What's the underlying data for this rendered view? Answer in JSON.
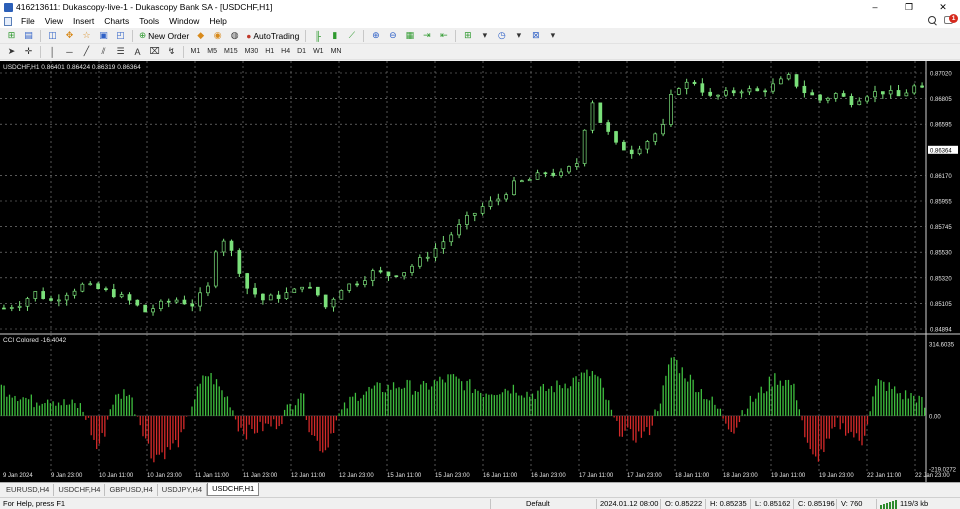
{
  "window": {
    "title": "416213611: Dukascopy-live-1 - Dukascopy Bank SA - [USDCHF,H1]",
    "controls": [
      "–",
      "❐",
      "✕"
    ]
  },
  "menu": {
    "items": [
      "File",
      "View",
      "Insert",
      "Charts",
      "Tools",
      "Window",
      "Help"
    ],
    "notification_count": "1"
  },
  "toolbar": {
    "new_order_label": "New Order",
    "autotrading_label": "AutoTrading",
    "timeframes": [
      "M1",
      "M5",
      "M15",
      "M30",
      "H1",
      "H4",
      "D1",
      "W1",
      "MN"
    ],
    "text_tool": "A"
  },
  "chart": {
    "symbol_info": "USDCHF,H1  0.86401 0.86424 0.86319 0.86364",
    "indicator_info": "CCI Colored -16.4042",
    "colors": {
      "background": "#000000",
      "candle": "#7be07b",
      "grid": "#8c8c8c",
      "cci_up": "#3fbf3f",
      "cci_down": "#d42a2a",
      "text": "#e6e6e6"
    },
    "current_price": "0.86364"
  },
  "chart_data": {
    "type": "candlestick",
    "price_axis_labels": [
      "0.87020",
      "0.86805",
      "0.86595",
      "0.86364",
      "0.86170",
      "0.85955",
      "0.85745",
      "0.85530",
      "0.85320",
      "0.85105",
      "0.84894"
    ],
    "cci_axis_labels": [
      "314.6035",
      "0.00",
      "-219.0272"
    ],
    "time_labels": [
      "9 Jan 2024",
      "9 Jan 23:00",
      "10 Jan 11:00",
      "10 Jan 23:00",
      "11 Jan 11:00",
      "11 Jan 23:00",
      "12 Jan 11:00",
      "12 Jan 23:00",
      "15 Jan 11:00",
      "15 Jan 23:00",
      "16 Jan 11:00",
      "16 Jan 23:00",
      "17 Jan 11:00",
      "17 Jan 23:00",
      "18 Jan 11:00",
      "18 Jan 23:00",
      "19 Jan 11:00",
      "19 Jan 23:00",
      "22 Jan 11:00",
      "22 Jan 23:00"
    ],
    "price_path": [
      [
        0,
        0.8508
      ],
      [
        2,
        0.8512
      ],
      [
        4,
        0.8521
      ],
      [
        6,
        0.8514
      ],
      [
        8,
        0.8521
      ],
      [
        10,
        0.8527
      ],
      [
        12,
        0.8524
      ],
      [
        14,
        0.852
      ],
      [
        16,
        0.8514
      ],
      [
        18,
        0.8505
      ],
      [
        20,
        0.8511
      ],
      [
        22,
        0.8515
      ],
      [
        24,
        0.8511
      ],
      [
        26,
        0.8525
      ],
      [
        27,
        0.8558
      ],
      [
        28,
        0.8566
      ],
      [
        29,
        0.8555
      ],
      [
        30,
        0.854
      ],
      [
        31,
        0.8525
      ],
      [
        33,
        0.8515
      ],
      [
        35,
        0.8518
      ],
      [
        37,
        0.8522
      ],
      [
        38,
        0.8528
      ],
      [
        40,
        0.8519
      ],
      [
        41,
        0.8509
      ],
      [
        43,
        0.8525
      ],
      [
        45,
        0.853
      ],
      [
        47,
        0.8538
      ],
      [
        49,
        0.8536
      ],
      [
        51,
        0.8539
      ],
      [
        53,
        0.8548
      ],
      [
        55,
        0.8558
      ],
      [
        57,
        0.857
      ],
      [
        59,
        0.8583
      ],
      [
        61,
        0.8593
      ],
      [
        63,
        0.86
      ],
      [
        65,
        0.8612
      ],
      [
        67,
        0.8616
      ],
      [
        69,
        0.8622
      ],
      [
        71,
        0.862
      ],
      [
        73,
        0.863
      ],
      [
        74,
        0.866
      ],
      [
        75,
        0.8682
      ],
      [
        76,
        0.8665
      ],
      [
        78,
        0.8645
      ],
      [
        80,
        0.864
      ],
      [
        82,
        0.8649
      ],
      [
        84,
        0.866
      ],
      [
        85,
        0.8685
      ],
      [
        86,
        0.8695
      ],
      [
        88,
        0.8698
      ],
      [
        90,
        0.8685
      ],
      [
        92,
        0.8688
      ],
      [
        94,
        0.8692
      ],
      [
        96,
        0.869
      ],
      [
        98,
        0.8695
      ],
      [
        100,
        0.8702
      ],
      [
        102,
        0.869
      ],
      [
        104,
        0.8683
      ],
      [
        106,
        0.8688
      ],
      [
        108,
        0.8682
      ],
      [
        110,
        0.8688
      ],
      [
        112,
        0.869
      ],
      [
        114,
        0.8686
      ],
      [
        116,
        0.8694
      ],
      [
        117,
        0.8691
      ]
    ],
    "cci_path": [
      [
        0,
        120
      ],
      [
        2,
        90
      ],
      [
        4,
        60
      ],
      [
        6,
        80
      ],
      [
        8,
        50
      ],
      [
        10,
        40
      ],
      [
        11,
        -20
      ],
      [
        12,
        -140
      ],
      [
        13,
        -80
      ],
      [
        14,
        60
      ],
      [
        16,
        110
      ],
      [
        18,
        -60
      ],
      [
        19,
        -170
      ],
      [
        21,
        -150
      ],
      [
        23,
        -90
      ],
      [
        24,
        40
      ],
      [
        26,
        180
      ],
      [
        27,
        150
      ],
      [
        28,
        100
      ],
      [
        29,
        60
      ],
      [
        30,
        -40
      ],
      [
        31,
        -70
      ],
      [
        33,
        -50
      ],
      [
        35,
        -30
      ],
      [
        37,
        60
      ],
      [
        38,
        110
      ],
      [
        39,
        -40
      ],
      [
        40,
        -110
      ],
      [
        41,
        -150
      ],
      [
        42,
        -50
      ],
      [
        43,
        10
      ],
      [
        45,
        90
      ],
      [
        47,
        110
      ],
      [
        49,
        120
      ],
      [
        51,
        130
      ],
      [
        53,
        110
      ],
      [
        55,
        140
      ],
      [
        57,
        160
      ],
      [
        59,
        130
      ],
      [
        61,
        100
      ],
      [
        63,
        110
      ],
      [
        65,
        120
      ],
      [
        67,
        90
      ],
      [
        69,
        110
      ],
      [
        71,
        130
      ],
      [
        73,
        160
      ],
      [
        75,
        180
      ],
      [
        76,
        130
      ],
      [
        77,
        40
      ],
      [
        78,
        -50
      ],
      [
        80,
        -90
      ],
      [
        82,
        -70
      ],
      [
        84,
        120
      ],
      [
        85,
        260
      ],
      [
        86,
        200
      ],
      [
        88,
        130
      ],
      [
        90,
        60
      ],
      [
        91,
        20
      ],
      [
        92,
        -30
      ],
      [
        93,
        -60
      ],
      [
        94,
        30
      ],
      [
        96,
        90
      ],
      [
        98,
        160
      ],
      [
        100,
        140
      ],
      [
        101,
        70
      ],
      [
        102,
        -120
      ],
      [
        103,
        -190
      ],
      [
        104,
        -150
      ],
      [
        105,
        -100
      ],
      [
        106,
        -30
      ],
      [
        108,
        -80
      ],
      [
        109,
        -120
      ],
      [
        110,
        20
      ],
      [
        111,
        140
      ],
      [
        112,
        130
      ],
      [
        114,
        90
      ],
      [
        116,
        80
      ],
      [
        117,
        40
      ]
    ],
    "price_range": [
      0.8487,
      0.8709
    ],
    "cci_range": [
      -219.0272,
      314.6035
    ]
  },
  "tabs": [
    "EURUSD,H4",
    "USDCHF,H4",
    "GBPUSD,H4",
    "USDJPY,H4",
    "USDCHF,H1"
  ],
  "active_tab": "USDCHF,H1",
  "status": {
    "help": "For Help, press F1",
    "profile": "Default",
    "datetime": "2024.01.12 08:00",
    "open": "O: 0.85222",
    "high": "H: 0.85235",
    "low": "L: 0.85162",
    "close": "C: 0.85196",
    "volume": "V: 760",
    "traffic": "119/3 kb"
  }
}
